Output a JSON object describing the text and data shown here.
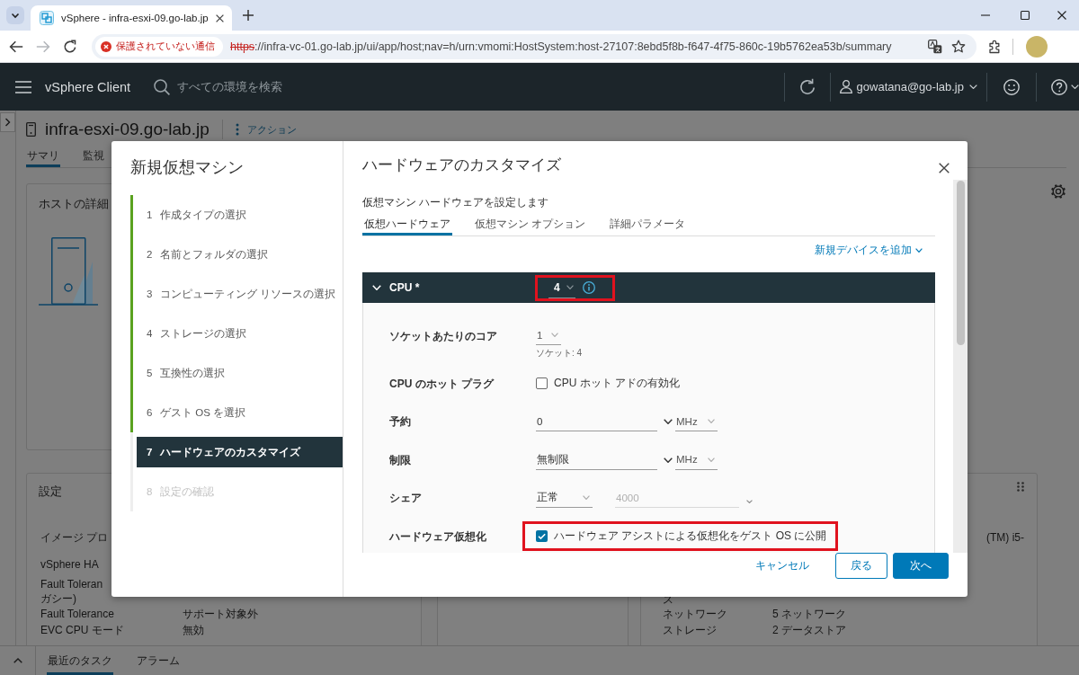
{
  "browser": {
    "tabs": [
      {
        "title": "vSphere - infra-esxi-09.go-lab.jp",
        "selected": true
      }
    ],
    "back_disabled": false,
    "forward_disabled": true,
    "connection_secure": false,
    "security_label": "保護されていない通信",
    "url_scheme": "https",
    "url_rest": "://infra-vc-01.go-lab.jp/ui/app/host;nav=h/urn:vmomi:HostSystem:host-27107:8ebd5f8b-f647-4f75-860c-19b5762ea53b/summary"
  },
  "app_header": {
    "product": "vSphere Client",
    "search": {
      "placeholder": "すべての環境を検索"
    },
    "user": "gowatana@go-lab.jp"
  },
  "host_page": {
    "title": "infra-esxi-09.go-lab.jp",
    "actions": "アクション",
    "tabs": [
      {
        "label": "サマリ",
        "selected": true
      },
      {
        "label": "監視",
        "selected": false
      }
    ],
    "details_card": {
      "title": "ホストの詳細"
    },
    "settings_card": {
      "title": "設定",
      "rows": [
        {
          "label": "イメージ プロ"
        },
        {
          "label": "vSphere HA"
        },
        {
          "label": "Fault Toleran\nガシー)"
        },
        {
          "label": "Fault Tolerance",
          "value": "サポート対象外"
        },
        {
          "label": "EVC CPU モード",
          "value": "無効"
        }
      ]
    },
    "hardware_card": {
      "rows": [
        {
          "value": "(TM) i5-"
        },
        {
          "label": "ス"
        },
        {
          "label": "ネットワーク",
          "value": "5 ネットワーク"
        },
        {
          "label": "ストレージ",
          "value": "2 データストア"
        }
      ]
    }
  },
  "bottom_panel": {
    "tabs": [
      {
        "label": "最近のタスク",
        "selected": true
      },
      {
        "label": "アラーム",
        "selected": false
      }
    ]
  },
  "wizard": {
    "title": "新規仮想マシン",
    "steps": [
      {
        "number": "1",
        "label": "作成タイプの選択",
        "completed": true,
        "selected": false
      },
      {
        "number": "2",
        "label": "名前とフォルダの選択",
        "completed": true,
        "selected": false
      },
      {
        "number": "3",
        "label": "コンピューティング リソースの選択",
        "completed": true,
        "selected": false
      },
      {
        "number": "4",
        "label": "ストレージの選択",
        "completed": true,
        "selected": false
      },
      {
        "number": "5",
        "label": "互換性の選択",
        "completed": true,
        "selected": false
      },
      {
        "number": "6",
        "label": "ゲスト OS を選択",
        "completed": true,
        "selected": false
      },
      {
        "number": "7",
        "label": "ハードウェアのカスタマイズ",
        "completed": false,
        "selected": true
      },
      {
        "number": "8",
        "label": "設定の確認",
        "completed": false,
        "selected": false
      }
    ],
    "page": {
      "title": "ハードウェアのカスタマイズ",
      "subtitle": "仮想マシン ハードウェアを設定します",
      "tabs": [
        {
          "label": "仮想ハードウェア",
          "selected": true
        },
        {
          "label": "仮想マシン オプション",
          "selected": false
        },
        {
          "label": "詳細パラメータ",
          "selected": false
        }
      ],
      "add_device": "新規デバイスを追加",
      "cpu": {
        "label": "CPU *",
        "value": "4",
        "expanded": true,
        "highlighted": true,
        "rows": [
          {
            "kind": "select",
            "label": "ソケットあたりのコア",
            "value": "1",
            "hint": "ソケット: 4",
            "disabled": false,
            "highlighted": false
          },
          {
            "kind": "checkbox",
            "label": "CPU のホット プラグ",
            "option": "CPU ホット アドの有効化",
            "checked": false,
            "disabled": false,
            "highlighted": false
          },
          {
            "kind": "amount",
            "label": "予約",
            "value": "0",
            "unit": "MHz",
            "disabled": false,
            "highlighted": false
          },
          {
            "kind": "amount",
            "label": "制限",
            "value": "無制限",
            "unit": "MHz",
            "disabled": false,
            "highlighted": false
          },
          {
            "kind": "shares",
            "label": "シェア",
            "preset": "正常",
            "value": "4000",
            "disabled": true,
            "highlighted": false
          },
          {
            "kind": "checkbox",
            "label": "ハードウェア仮想化",
            "option": "ハードウェア アシストによる仮想化をゲスト OS に公開",
            "checked": true,
            "disabled": false,
            "highlighted": true
          }
        ]
      }
    },
    "buttons": {
      "cancel": "キャンセル",
      "back": "戻る",
      "next": "次へ"
    }
  }
}
